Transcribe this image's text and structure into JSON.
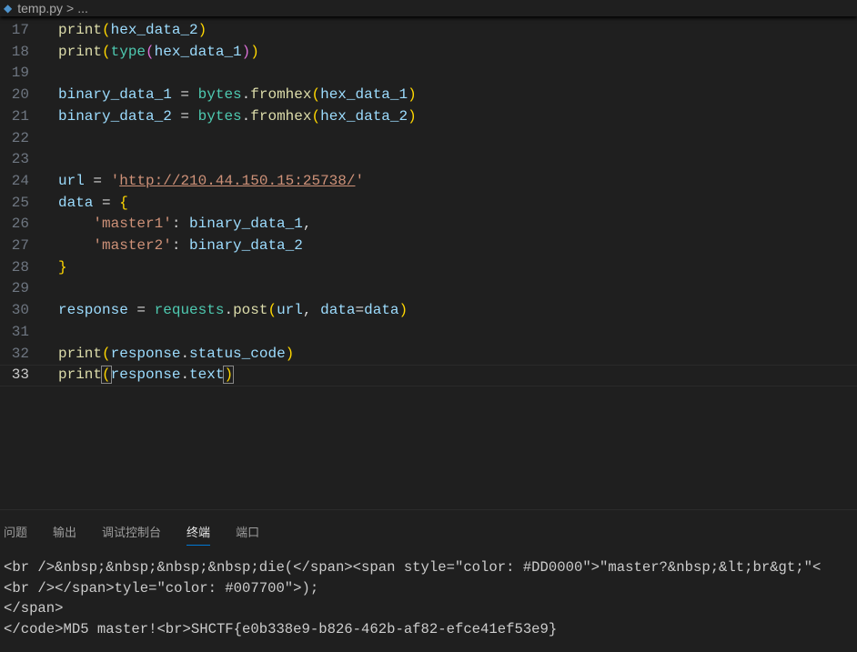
{
  "breadcrumb": {
    "file": "temp.py",
    "sep": ">",
    "more": "..."
  },
  "editor": {
    "lines": [
      {
        "n": "17",
        "html": "<span class='f'>print</span><span class='p1'>(</span>hex_data_2<span class='p1'>)</span>"
      },
      {
        "n": "18",
        "html": "<span class='f'>print</span><span class='p1'>(</span><span class='c'>type</span><span class='p2'>(</span>hex_data_1<span class='p2'>)</span><span class='p1'>)</span>"
      },
      {
        "n": "19",
        "html": ""
      },
      {
        "n": "20",
        "html": "binary_data_1 <span class='o'>=</span> <span class='c'>bytes</span><span class='o'>.</span><span class='f'>fromhex</span><span class='p1'>(</span>hex_data_1<span class='p1'>)</span>"
      },
      {
        "n": "21",
        "html": "binary_data_2 <span class='o'>=</span> <span class='c'>bytes</span><span class='o'>.</span><span class='f'>fromhex</span><span class='p1'>(</span>hex_data_2<span class='p1'>)</span>"
      },
      {
        "n": "22",
        "html": ""
      },
      {
        "n": "23",
        "html": ""
      },
      {
        "n": "24",
        "html": "url <span class='o'>=</span> <span class='s'>'<span class='u'>http://210.44.150.15:25738/</span>'</span>"
      },
      {
        "n": "25",
        "html": "data <span class='o'>=</span> <span class='p1'>{</span>"
      },
      {
        "n": "26",
        "html": "    <span class='s'>'master1'</span><span class='o'>:</span> binary_data_1<span class='o'>,</span>"
      },
      {
        "n": "27",
        "html": "    <span class='s'>'master2'</span><span class='o'>:</span> binary_data_2"
      },
      {
        "n": "28",
        "html": "<span class='p1'>}</span>"
      },
      {
        "n": "29",
        "html": ""
      },
      {
        "n": "30",
        "html": "response <span class='o'>=</span> <span class='c'>requests</span><span class='o'>.</span><span class='f'>post</span><span class='p1'>(</span>url<span class='o'>,</span> data<span class='o'>=</span>data<span class='p1'>)</span>"
      },
      {
        "n": "31",
        "html": ""
      },
      {
        "n": "32",
        "html": "<span class='f'>print</span><span class='p1'>(</span>response<span class='o'>.</span>status_code<span class='p1'>)</span>"
      },
      {
        "n": "33",
        "html": "<span class='f'>print</span><span class='p1' style='outline:1px solid #888'>(</span>response<span class='o'>.</span>text<span class='p1' style='outline:1px solid #888'>)</span>"
      }
    ]
  },
  "panel": {
    "tabs": [
      "问题",
      "输出",
      "调试控制台",
      "终端",
      "端口"
    ],
    "active": 3,
    "terminal": [
      "<br />&nbsp;&nbsp;&nbsp;&nbsp;die(</span><span style=\"color: #DD0000\">\"master?&nbsp;&lt;br&gt;\"<",
      "<br /></span>tyle=\"color: #007700\">);",
      "</span>",
      "</code>MD5 master!<br>SHCTF{e0b338e9-b826-462b-af82-efce41ef53e9}"
    ]
  }
}
